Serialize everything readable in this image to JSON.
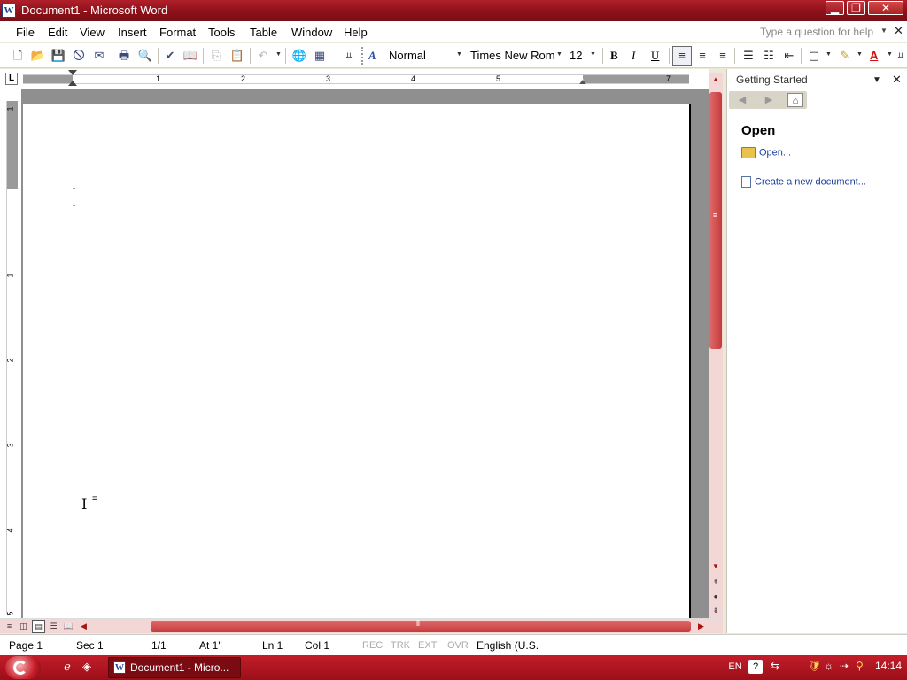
{
  "window": {
    "title": "Document1 - Microsoft Word",
    "app_icon_letter": "W",
    "controls": [
      "minimize-icon",
      "maximize-icon",
      "close-icon"
    ]
  },
  "menubar": {
    "items": [
      {
        "label": "File",
        "accel": "F"
      },
      {
        "label": "Edit",
        "accel": "E"
      },
      {
        "label": "View",
        "accel": "V"
      },
      {
        "label": "Insert",
        "accel": "I"
      },
      {
        "label": "Format",
        "accel": "o"
      },
      {
        "label": "Tools",
        "accel": "T"
      },
      {
        "label": "Table",
        "accel": "a"
      },
      {
        "label": "Window",
        "accel": "W"
      },
      {
        "label": "Help",
        "accel": "H"
      }
    ],
    "help_box_placeholder": "Type a question for help"
  },
  "toolbar": {
    "style": "Normal",
    "font": "Times New Rom",
    "size": "12",
    "bold": "B",
    "italic": "I",
    "underline": "U",
    "font_color_glyph": "A",
    "style_glyph": "A"
  },
  "ruler": {
    "tab_selector": "L",
    "numbers": [
      "1",
      "2",
      "3",
      "4",
      "5",
      "7"
    ],
    "vertical_numbers": [
      "1",
      "1",
      "2",
      "3",
      "4",
      "5"
    ]
  },
  "taskpane": {
    "title": "Getting Started",
    "section": "Open",
    "links": [
      "Open...",
      "Create a new document..."
    ]
  },
  "statusbar": {
    "page": "Page 1",
    "sec": "Sec 1",
    "pages": "1/1",
    "at": "At 1\"",
    "ln": "Ln 1",
    "col": "Col 1",
    "rec": "REC",
    "trk": "TRK",
    "ext": "EXT",
    "ovr": "OVR",
    "language": "English (U.S."
  },
  "taskbar": {
    "item_label": "Document1 - Micro...",
    "language": "EN",
    "help_glyph": "?",
    "time": "14:14"
  },
  "colors": {
    "titlebar": "#8c1119",
    "taskbar": "#9c0e18",
    "link": "#1a3ea0",
    "scrollbar_thumb": "#c43c3c"
  }
}
